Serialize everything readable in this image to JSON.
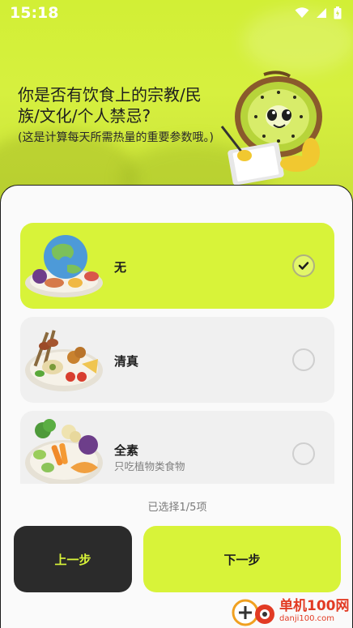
{
  "status_bar": {
    "time": "15:18",
    "icons": [
      "wifi-icon",
      "signal-icon",
      "battery-icon"
    ]
  },
  "header": {
    "question": "你是否有饮食上的宗教/民族/文化/个人禁忌?",
    "sub_question": "(这是计算每天所需热量的重要参数哦。)",
    "mascot": "kiwi-mascot-with-clipboard"
  },
  "options": [
    {
      "title": "无",
      "description": "",
      "selected": true,
      "image": "world-food-plate"
    },
    {
      "title": "清真",
      "description": "",
      "selected": false,
      "image": "halal-food-plate"
    },
    {
      "title": "全素",
      "description": "只吃植物类食物",
      "selected": false,
      "image": "vegan-food-plate"
    }
  ],
  "selection_count": "已选择1/5项",
  "buttons": {
    "prev": "上一步",
    "next": "下一步"
  },
  "watermark": {
    "name": "单机100网",
    "url": "danji100.com"
  },
  "colors": {
    "accent": "#d8f339",
    "dark": "#2b2b2b",
    "card": "#f0f0f0"
  }
}
